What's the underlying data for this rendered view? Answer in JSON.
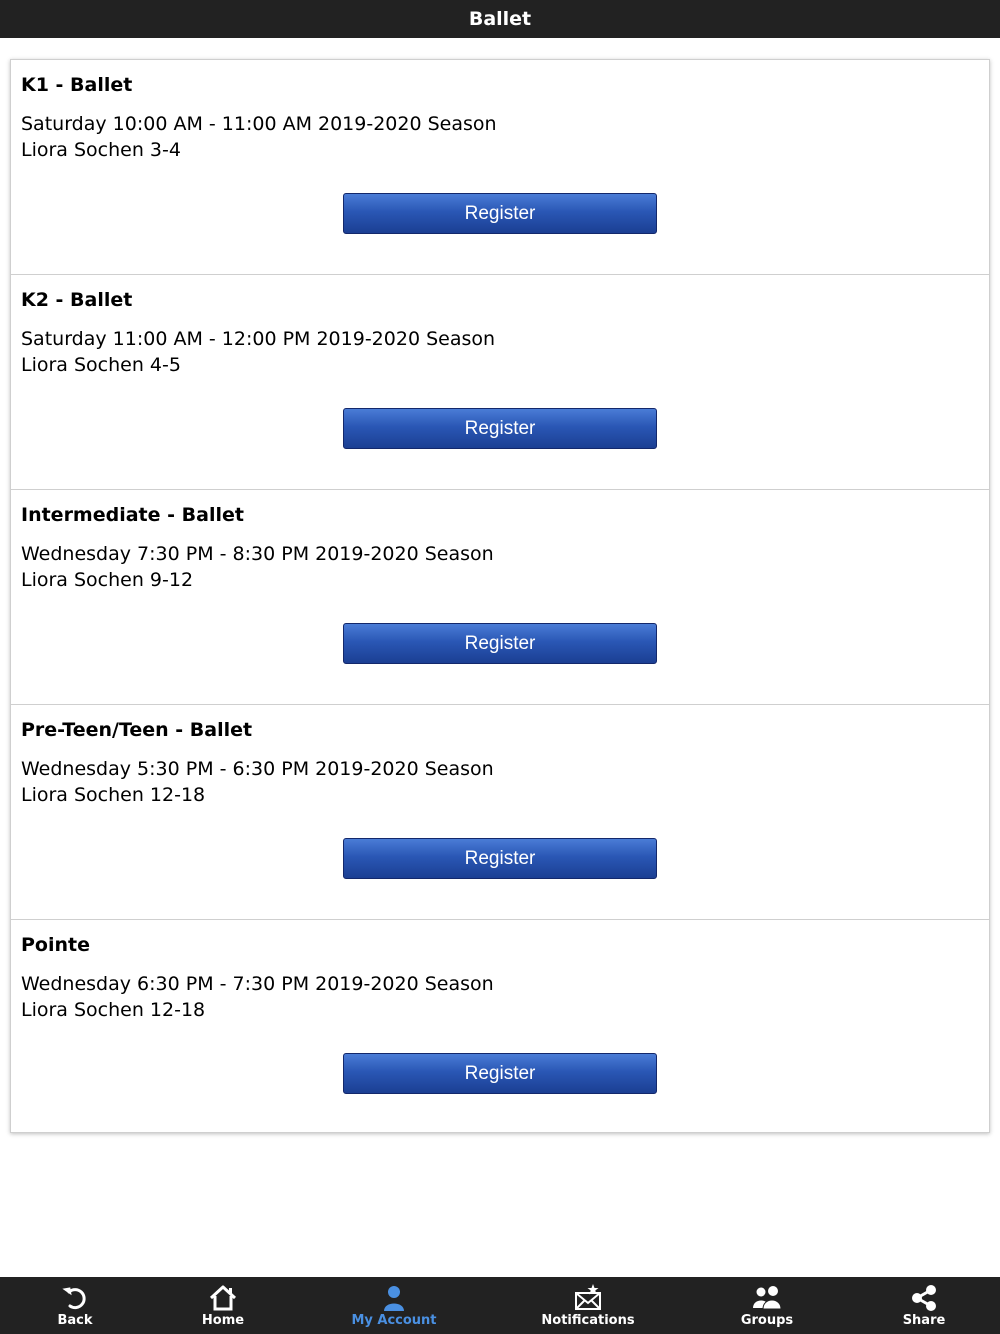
{
  "header": {
    "title": "Ballet"
  },
  "classes": [
    {
      "title": "K1 - Ballet",
      "schedule": "Saturday 10:00 AM - 11:00 AM 2019-2020 Season",
      "details": "Liora Sochen 3-4",
      "button": "Register"
    },
    {
      "title": "K2 - Ballet",
      "schedule": "Saturday 11:00 AM - 12:00 PM 2019-2020 Season",
      "details": "Liora Sochen 4-5",
      "button": "Register"
    },
    {
      "title": "Intermediate - Ballet",
      "schedule": "Wednesday 7:30 PM - 8:30 PM 2019-2020 Season",
      "details": "Liora Sochen 9-12",
      "button": "Register"
    },
    {
      "title": "Pre-Teen/Teen - Ballet",
      "schedule": "Wednesday 5:30 PM - 6:30 PM 2019-2020 Season",
      "details": "Liora Sochen 12-18",
      "button": "Register"
    },
    {
      "title": "Pointe",
      "schedule": "Wednesday 6:30 PM - 7:30 PM 2019-2020 Season",
      "details": "Liora Sochen 12-18",
      "button": "Register"
    }
  ],
  "tabbar": {
    "items": [
      {
        "label": "Back",
        "icon": "back-arrow-icon"
      },
      {
        "label": "Home",
        "icon": "home-icon"
      },
      {
        "label": "My Account",
        "icon": "person-icon",
        "active": true
      },
      {
        "label": "Notifications",
        "icon": "envelope-star-icon"
      },
      {
        "label": "Groups",
        "icon": "group-icon"
      },
      {
        "label": "Share",
        "icon": "share-icon"
      }
    ]
  },
  "colors": {
    "bar": "#222222",
    "active_tab": "#4a90e2",
    "button": "#2a57b5"
  }
}
